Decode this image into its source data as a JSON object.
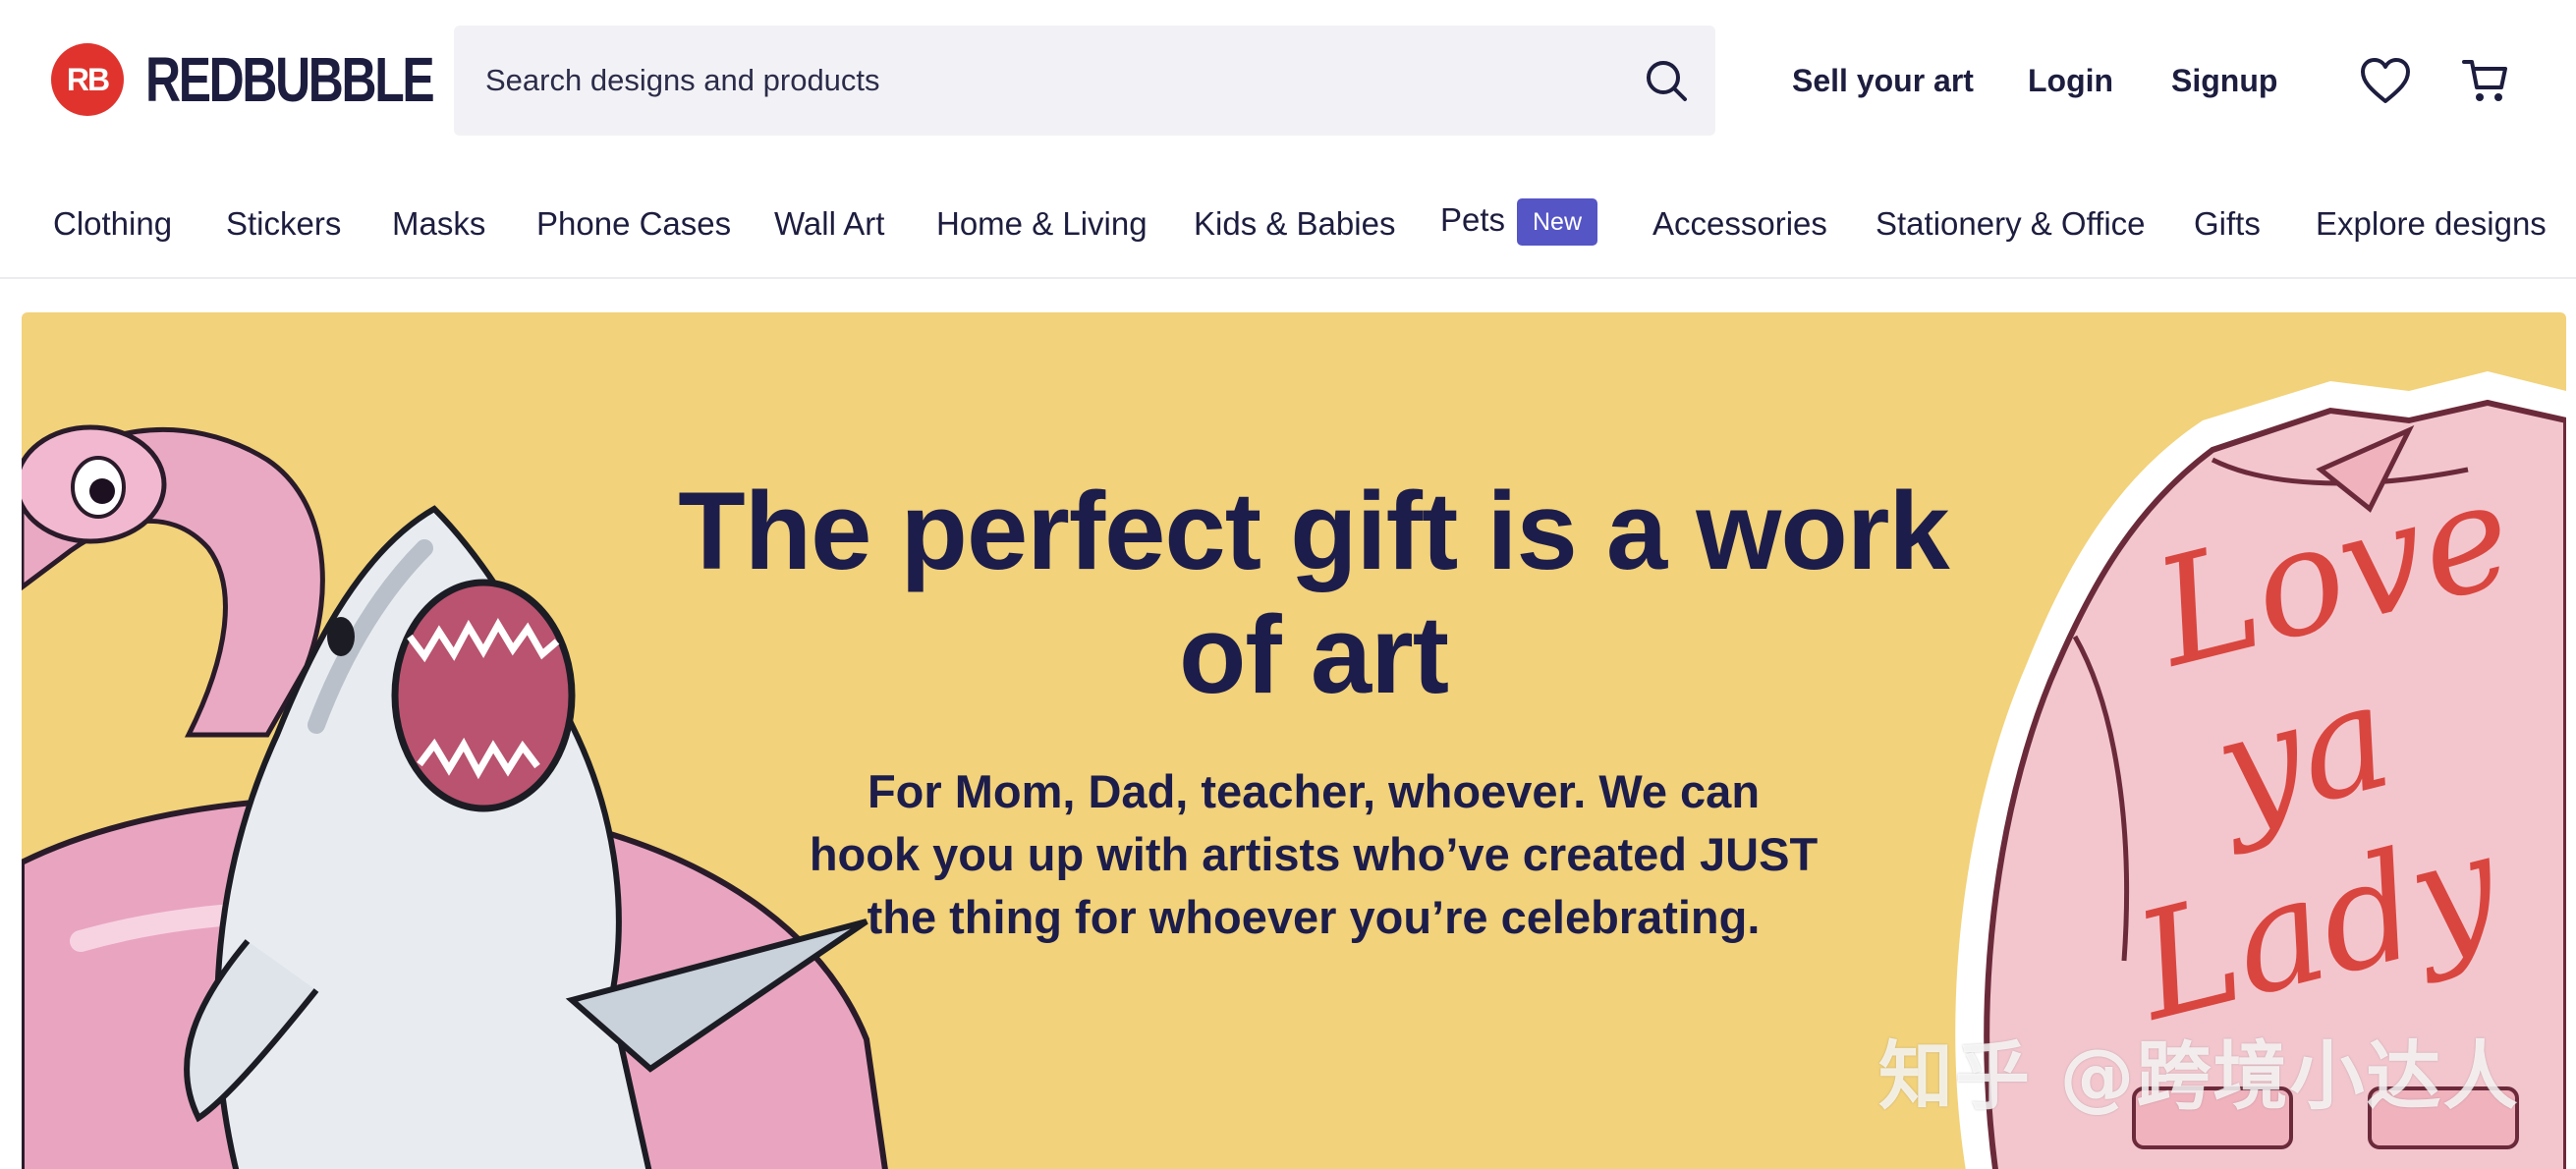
{
  "brand": {
    "badge_text": "RB",
    "name": "REDBUBBLE",
    "color": "#e0332e"
  },
  "search": {
    "placeholder": "Search designs and products",
    "icon": "search-icon"
  },
  "header_links": {
    "sell": "Sell your art",
    "login": "Login",
    "signup": "Signup"
  },
  "header_icons": [
    "heart-icon",
    "cart-icon"
  ],
  "categories": [
    {
      "label": "Clothing"
    },
    {
      "label": "Stickers"
    },
    {
      "label": "Masks"
    },
    {
      "label": "Phone Cases"
    },
    {
      "label": "Wall Art"
    },
    {
      "label": "Home & Living"
    },
    {
      "label": "Kids & Babies"
    },
    {
      "label": "Pets",
      "badge": "New"
    },
    {
      "label": "Accessories"
    },
    {
      "label": "Stationery & Office"
    },
    {
      "label": "Gifts"
    },
    {
      "label": "Explore designs"
    }
  ],
  "hero": {
    "title": "The perfect gift is a work of art",
    "subtitle": "For Mom, Dad, teacher, whoever. We can hook you up with artists who’ve created JUST the thing for whoever you’re celebrating.",
    "background": "#f2d27a",
    "jacket_text": "Love ya Lady"
  },
  "watermark": "知乎 @跨境小达人",
  "colors": {
    "text": "#1d1d3f",
    "badge": "#5555c6",
    "search_bg": "#f2f2f6"
  }
}
